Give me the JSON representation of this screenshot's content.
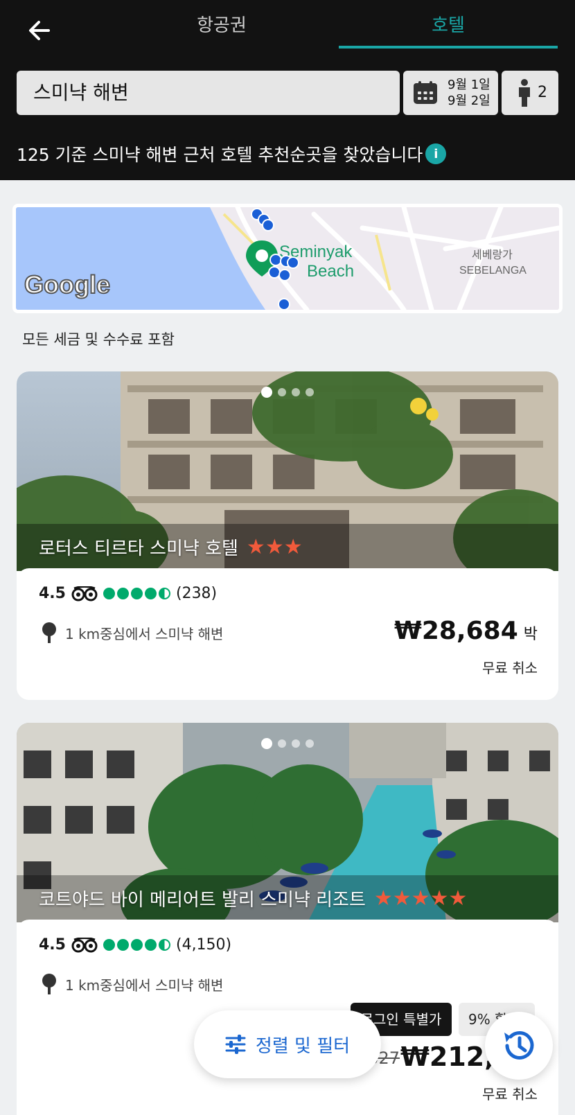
{
  "header": {
    "tabs": [
      {
        "label": "항공권"
      },
      {
        "label": "호텔"
      }
    ],
    "location": "스미냑 해변",
    "dates": {
      "checkin": "9월 1일",
      "checkout": "9월 2일"
    },
    "guests": "2",
    "summary": "125 기준 스미냑 해변 근처 호텔 추천순곳을 찾았습니다"
  },
  "map": {
    "label_beach_1": "Seminyak",
    "label_beach_2": "Beach",
    "label_area_ko": "세베랑가",
    "label_area_en": "SEBELANGA",
    "logo": "Google"
  },
  "taxes_note": "모든 세금 및 수수료 포함",
  "hotels": [
    {
      "name": "로터스 티르타 스미냑 호텔",
      "stars": 3,
      "score": "4.5",
      "bubbles": 4.5,
      "reviews": "(238)",
      "distance": "1 km중심에서 스미냑 해변",
      "price": "₩28,684",
      "per": "박",
      "cancel": "무료 취소"
    },
    {
      "name": "코트야드 바이 메리어트 발리 스미냑 리조트",
      "stars": 5,
      "score": "4.5",
      "bubbles": 4.5,
      "reviews": "(4,150)",
      "distance": "1 km중심에서 스미냑 해변",
      "badge": "로그인 특별가",
      "discount": "9% 할인",
      "old_price": "₩234,327",
      "price": "₩212,49",
      "cancel": "무료 취소"
    }
  ],
  "fab": {
    "filter_label": "정렬 및 필터"
  },
  "colors": {
    "accent": "#1aa6a6",
    "star": "#f15a3b",
    "tripadvisor": "#00aa6c",
    "link": "#1b67d0"
  }
}
